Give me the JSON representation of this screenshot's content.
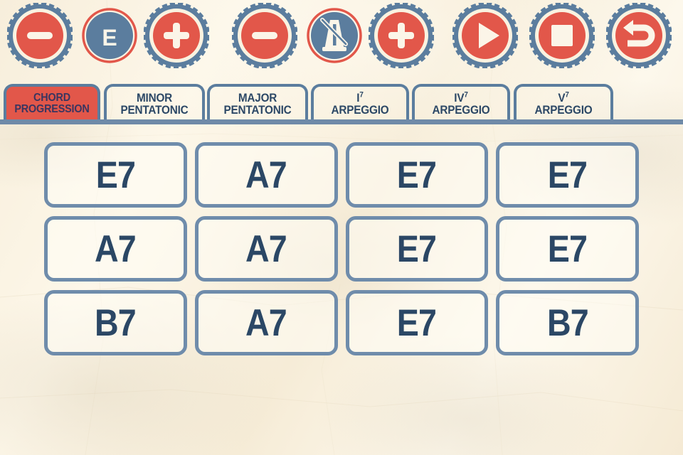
{
  "theme": {
    "red": "#e2574a",
    "blue": "#5b7d9e",
    "dark_blue_text": "#2b4765",
    "paper": "#faf2e0",
    "cell_border": "#6f8cab"
  },
  "toolbar": {
    "buttons": [
      {
        "name": "key-decrement-button",
        "icon": "minus-icon",
        "style": "red",
        "label": ""
      },
      {
        "name": "key-display-button",
        "icon": "letter-e",
        "style": "blue",
        "label": "E"
      },
      {
        "name": "key-increment-button",
        "icon": "plus-icon",
        "style": "red",
        "label": ""
      },
      {
        "name": "tempo-decrement-button",
        "icon": "minus-icon",
        "style": "red",
        "label": ""
      },
      {
        "name": "metronome-toggle-button",
        "icon": "metronome-muted-icon",
        "style": "blue",
        "label": ""
      },
      {
        "name": "tempo-increment-button",
        "icon": "plus-icon",
        "style": "red",
        "label": ""
      },
      {
        "name": "play-button",
        "icon": "play-icon",
        "style": "red",
        "label": ""
      },
      {
        "name": "stop-button",
        "icon": "stop-icon",
        "style": "red",
        "label": ""
      },
      {
        "name": "undo-button",
        "icon": "undo-arrow-icon",
        "style": "red",
        "label": ""
      }
    ],
    "key_value": "E"
  },
  "tabs": [
    {
      "line1": "CHORD",
      "line2": "PROGRESSION",
      "sup1": "",
      "active": true
    },
    {
      "line1": "MINOR",
      "line2": "PENTATONIC",
      "sup1": "",
      "active": false
    },
    {
      "line1": "MAJOR",
      "line2": "PENTATONIC",
      "sup1": "",
      "active": false
    },
    {
      "line1": "I",
      "line2": "ARPEGGIO",
      "sup1": "7",
      "active": false
    },
    {
      "line1": "IV",
      "line2": "ARPEGGIO",
      "sup1": "7",
      "active": false
    },
    {
      "line1": "V",
      "line2": "ARPEGGIO",
      "sup1": "7",
      "active": false
    }
  ],
  "chord_grid": {
    "rows": 3,
    "cols": 4,
    "cells": [
      "E7",
      "A7",
      "E7",
      "E7",
      "A7",
      "A7",
      "E7",
      "E7",
      "B7",
      "A7",
      "E7",
      "B7"
    ]
  }
}
